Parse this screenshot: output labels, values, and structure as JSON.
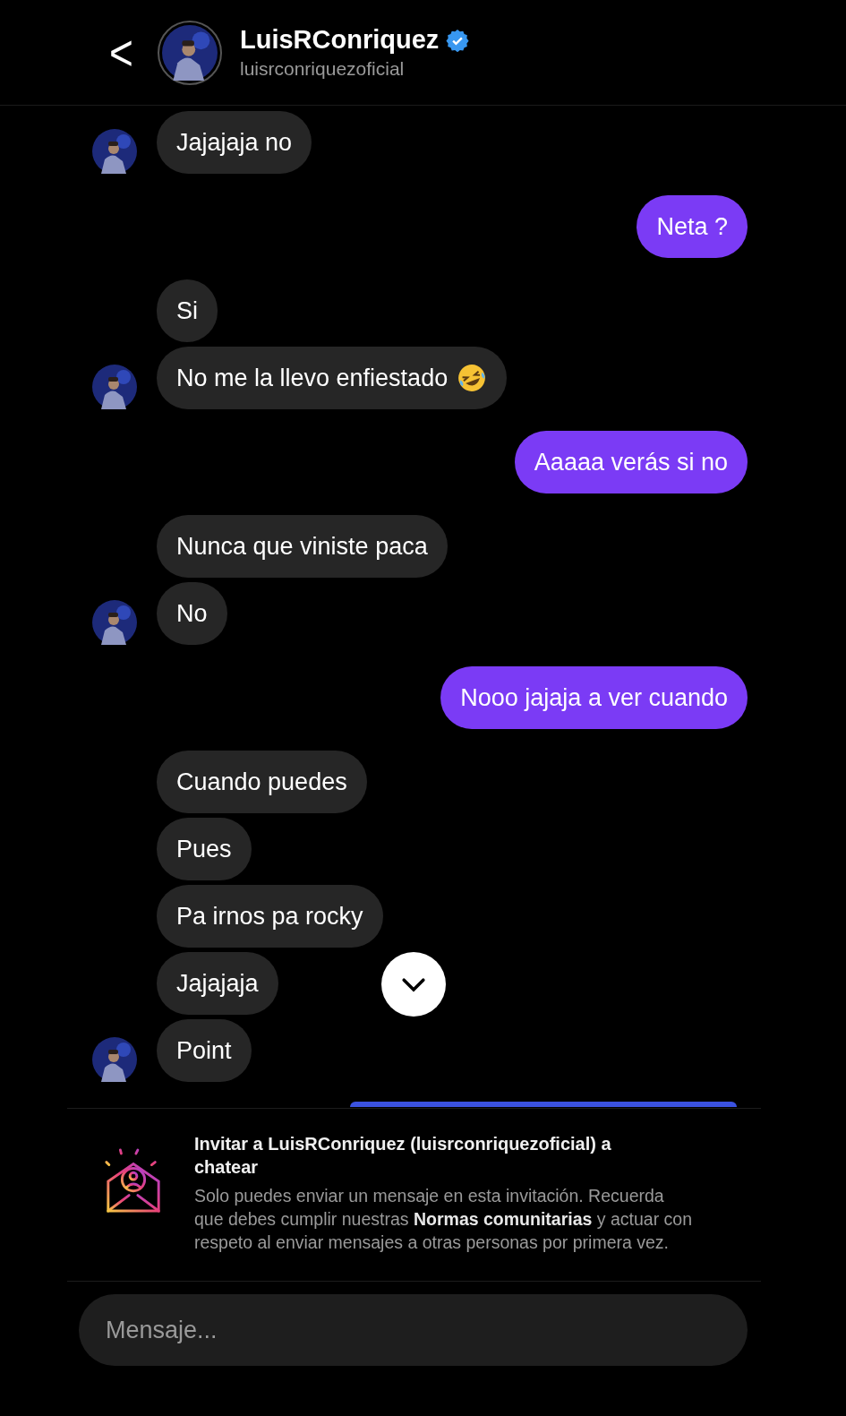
{
  "header": {
    "back_icon": "<",
    "name": "LuisRConriquez",
    "verified": true,
    "username": "luisrconriquezoficial"
  },
  "messages": [
    {
      "kind": "them",
      "text": "Jajajaja no",
      "avatar": true,
      "emoji": false
    },
    {
      "kind": "me",
      "text": "Neta ?",
      "avatar": false,
      "emoji": false
    },
    {
      "kind": "them",
      "text": "Si",
      "avatar": false,
      "emoji": false
    },
    {
      "kind": "them",
      "text": "No me la llevo enfiestado",
      "avatar": true,
      "emoji": true
    },
    {
      "kind": "me",
      "text": "Aaaaa verás si no",
      "avatar": false,
      "emoji": false
    },
    {
      "kind": "them",
      "text": "Nunca que viniste paca",
      "avatar": false,
      "emoji": false
    },
    {
      "kind": "them",
      "text": "No",
      "avatar": true,
      "emoji": false
    },
    {
      "kind": "me",
      "text": "Nooo jajaja a ver cuando",
      "avatar": false,
      "emoji": false
    },
    {
      "kind": "them",
      "text": "Cuando puedes",
      "avatar": false,
      "emoji": false
    },
    {
      "kind": "them",
      "text": "Pues",
      "avatar": false,
      "emoji": false
    },
    {
      "kind": "them",
      "text": "Pa irnos pa rocky",
      "avatar": false,
      "emoji": false
    },
    {
      "kind": "them",
      "text": "Jajajaja",
      "avatar": false,
      "emoji": false
    },
    {
      "kind": "them",
      "text": "Point",
      "avatar": true,
      "emoji": false
    }
  ],
  "invite": {
    "title": "Invitar a LuisRConriquez (luisrconriquezoficial) a chatear",
    "body": "Solo puedes enviar un mensaje en esta invitación. Recuerda que debes cumplir nuestras **Normas comunitarias** y actuar con respeto al enviar mensajes a otras personas por primera vez."
  },
  "composer": {
    "placeholder": "Mensaje..."
  }
}
